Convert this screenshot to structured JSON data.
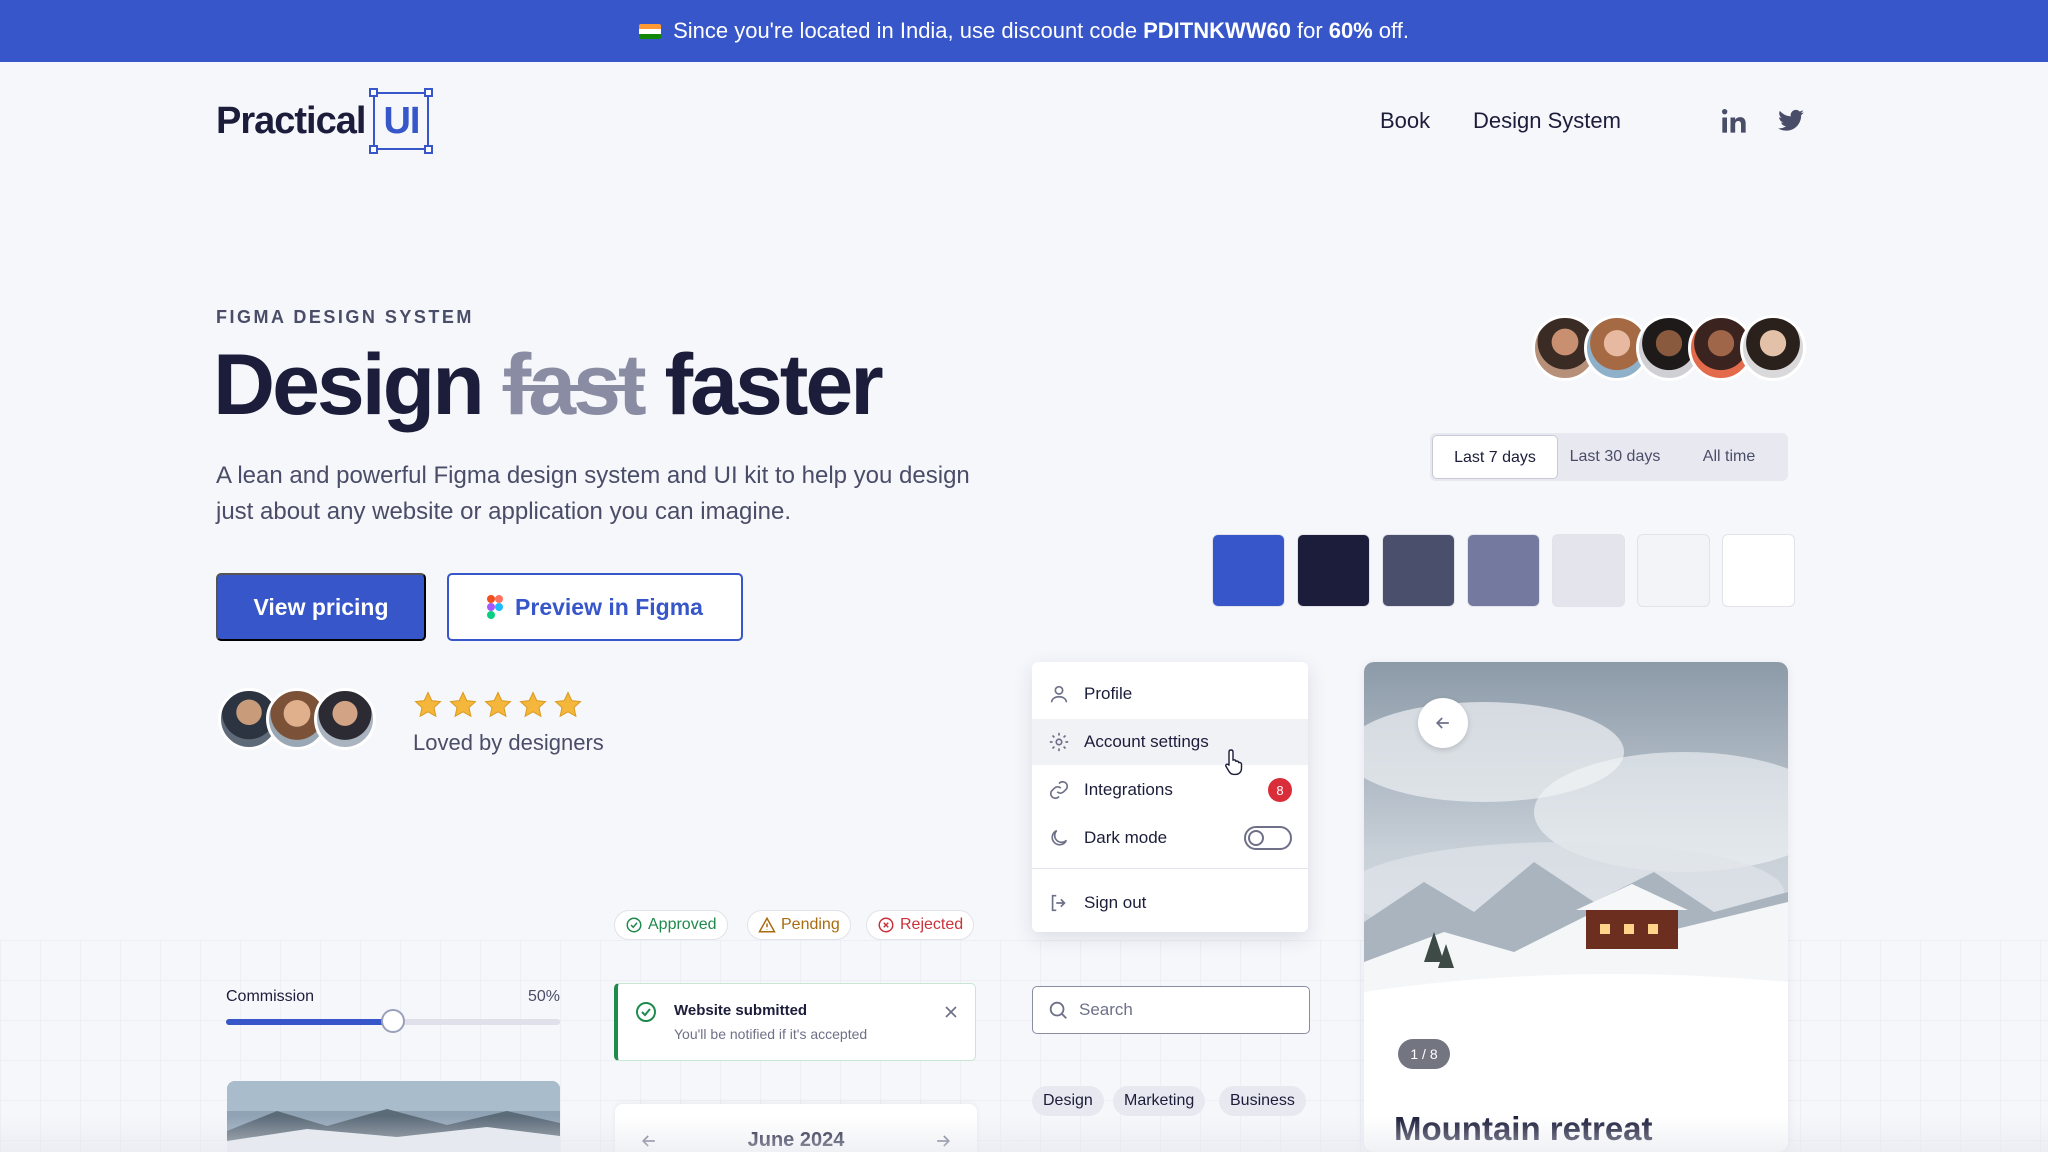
{
  "banner": {
    "text_before": "Since you're located in India, use discount code",
    "code": "PDITNKWW60",
    "text_mid": "for",
    "discount": "60%",
    "text_after": "off."
  },
  "header": {
    "logo_text": "Practical",
    "logo_highlight": "UI",
    "nav": [
      "Book",
      "Design System"
    ],
    "social": [
      "linkedin-icon",
      "twitter-icon"
    ]
  },
  "hero": {
    "eyebrow": "FIGMA DESIGN SYSTEM",
    "headline_start": "Design",
    "headline_strike": "fast",
    "headline_end": "faster",
    "description": "A lean and powerful Figma design system and UI kit to help you design just about any website or application you can imagine.",
    "primary_button": "View pricing",
    "secondary_button": "Preview in Figma",
    "rating_stars": 5,
    "rating_label": "Loved by designers"
  },
  "segmented": {
    "options": [
      "Last 7 days",
      "Last 30 days",
      "All time"
    ],
    "selected": "Last 7 days"
  },
  "swatches": [
    "#3656c9",
    "#1b1d3a",
    "#4a4f6b",
    "#7479a0",
    "#e3e4ec",
    "#f3f4f8",
    "#ffffff"
  ],
  "menu": {
    "items": [
      {
        "label": "Profile",
        "icon": "user-icon"
      },
      {
        "label": "Account settings",
        "icon": "gear-icon"
      },
      {
        "label": "Integrations",
        "icon": "link-icon",
        "badge": "8"
      },
      {
        "label": "Dark mode",
        "icon": "moon-icon",
        "toggle": false
      },
      {
        "label": "Sign out",
        "icon": "sign-out-icon"
      }
    ]
  },
  "card": {
    "counter": "1 / 8",
    "title": "Mountain retreat"
  },
  "statuses": {
    "approved": "Approved",
    "pending": "Pending",
    "rejected": "Rejected"
  },
  "slider": {
    "label": "Commission",
    "value_text": "50%",
    "value": 0.5
  },
  "toast": {
    "title": "Website submitted",
    "message": "You'll be notified if it's accepted"
  },
  "search": {
    "placeholder": "Search"
  },
  "tags": [
    "Design",
    "Marketing",
    "Business"
  ],
  "calendar": {
    "month": "June 2024"
  },
  "colors": {
    "brand": "#3656c9",
    "ink": "#1b1d3a",
    "success": "#1e8a4c",
    "warning": "#a86b10",
    "danger": "#c8333b"
  }
}
